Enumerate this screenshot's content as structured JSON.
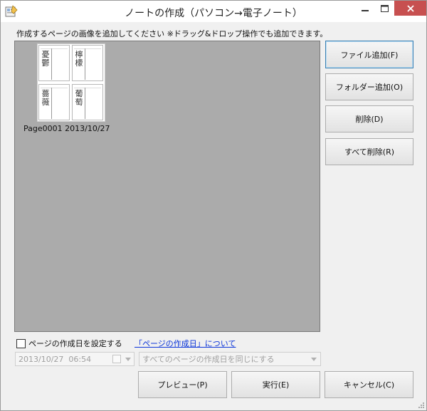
{
  "window": {
    "title": "ノートの作成（パソコン→電子ノート）"
  },
  "instruction": "作成するページの画像を追加してください ※ドラッグ&ドロップ操作でも追加できます。",
  "pages": [
    {
      "caption": "Page0001  2013/10/27",
      "cells": [
        "憂鬱",
        "檸檬",
        "薔薇",
        "葡萄"
      ]
    }
  ],
  "buttons": {
    "add_file": "ファイル追加(F)",
    "add_folder": "フォルダー追加(O)",
    "delete": "削除(D)",
    "delete_all": "すべて削除(R)",
    "preview": "プレビュー(P)",
    "run": "実行(E)",
    "cancel": "キャンセル(C)"
  },
  "set_date": {
    "checkbox_label": "ページの作成日を設定する",
    "checked": false,
    "help_link": "「ページの作成日」について",
    "date_value": "2013/10/27  06:54",
    "mode_value": "すべてのページの作成日を同じにする"
  },
  "colors": {
    "drop_area_bg": "#ababab",
    "close_button": "#c75050",
    "link": "#0b35d9"
  }
}
